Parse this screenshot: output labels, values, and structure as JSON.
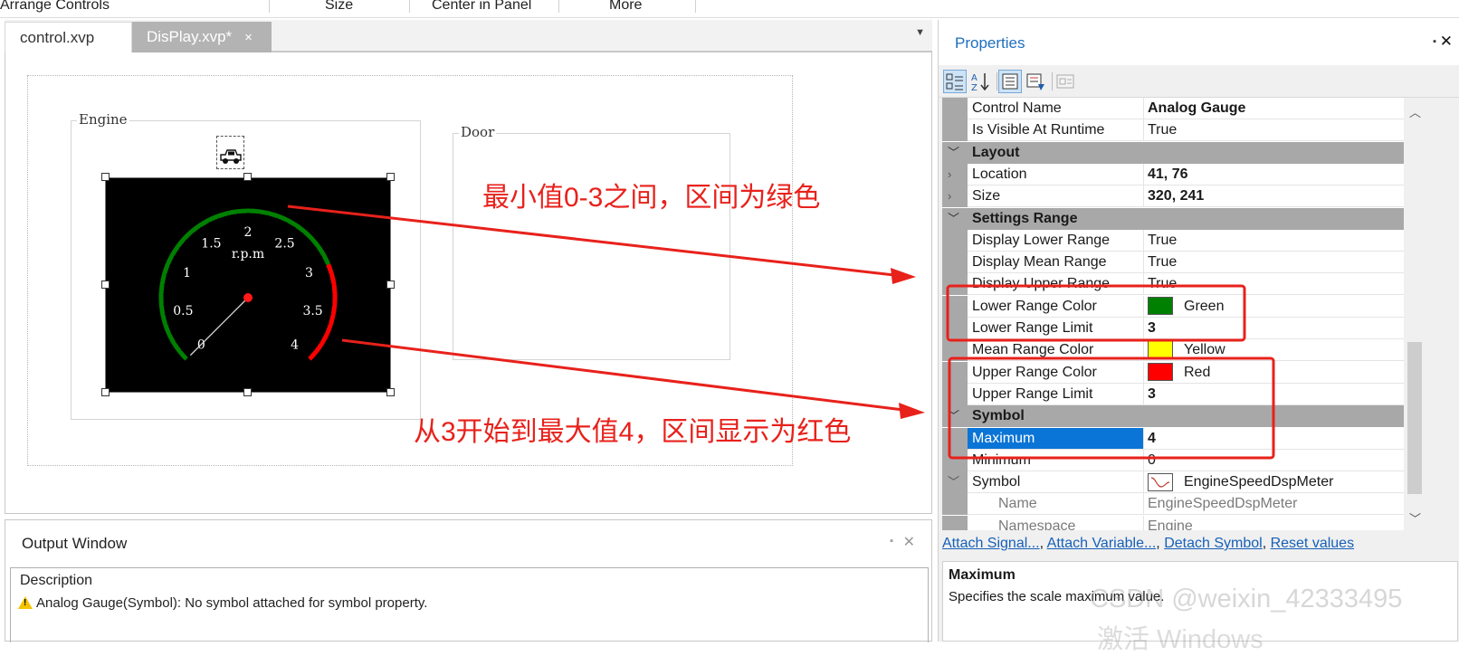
{
  "ribbon": {
    "items": [
      "Arrange Controls",
      "Size",
      "Center in Panel",
      "More"
    ]
  },
  "designer": {
    "tabs": [
      {
        "label": "control.xvp"
      },
      {
        "label": "DisPlay.xvp*",
        "close": "×"
      }
    ],
    "tab_menu_icon": "triangle-down",
    "groups": {
      "engine": "Engine",
      "door": "Door"
    },
    "gauge": {
      "background": "#000000",
      "unit": "r.p.m",
      "min": 0,
      "max": 4,
      "labels": [
        "0",
        "0.5",
        "1",
        "1.5",
        "2",
        "2.5",
        "3",
        "3.5",
        "4"
      ],
      "needle_value": 0,
      "lower_color": "#008000",
      "upper_color": "#ff0000"
    },
    "icon": "car-icon"
  },
  "annotations": {
    "note_top": "最小值0-3之间，区间为绿色",
    "note_bottom": "从3开始到最大值4，区间显示为红色",
    "color": "#e8211b"
  },
  "output": {
    "title": "Output Window",
    "pin": "▪",
    "close": "✕",
    "column": "Description",
    "message": "Analog Gauge(Symbol): No symbol attached for symbol property."
  },
  "properties": {
    "title": "Properties",
    "pin": "▪",
    "close": "✕",
    "toolbar": [
      "categorized",
      "alphabetical",
      "properties",
      "events",
      "property-pages"
    ],
    "rows": [
      {
        "name": "Control Name",
        "value": "Analog Gauge",
        "bold": true
      },
      {
        "name": "Is Visible At Runtime",
        "value": "True"
      },
      {
        "name": "Layout",
        "category": true
      },
      {
        "name": "Location",
        "value": "41, 76",
        "bold": true,
        "expand": true
      },
      {
        "name": "Size",
        "value": "320, 241",
        "bold": true,
        "expand": true
      },
      {
        "name": "Settings Range",
        "category": true
      },
      {
        "name": "Display Lower Range",
        "value": "True"
      },
      {
        "name": "Display Mean Range",
        "value": "True"
      },
      {
        "name": "Display Upper Range",
        "value": "True"
      },
      {
        "name": "Lower Range Color",
        "value": "Green",
        "swatch": "#008000"
      },
      {
        "name": "Lower Range Limit",
        "value": "3",
        "bold": true
      },
      {
        "name": "Mean Range Color",
        "value": "Yellow",
        "swatch": "#ffff00"
      },
      {
        "name": "Upper Range Color",
        "value": "Red",
        "swatch": "#ff0000"
      },
      {
        "name": "Upper Range Limit",
        "value": "3",
        "bold": true
      },
      {
        "name": "Symbol",
        "category": true
      },
      {
        "name": "Maximum",
        "value": "4",
        "bold": true,
        "selected": true
      },
      {
        "name": "Minimum",
        "value": "0"
      },
      {
        "name": "Symbol",
        "value": "EngineSpeedDspMeter",
        "symbol": true,
        "expand_open": true
      },
      {
        "name": "Name",
        "value": "EngineSpeedDspMeter",
        "sub": true
      },
      {
        "name": "Namespace",
        "value": "Engine",
        "sub": true
      }
    ],
    "commands": [
      "Attach Signal...",
      "Attach Variable...",
      "Detach Symbol",
      "Reset values"
    ],
    "desc_title": "Maximum",
    "desc_text": "Specifies the scale maximum value."
  },
  "watermark": {
    "line1": "CSDN @weixin_42333495",
    "line2": "激活 Windows"
  }
}
